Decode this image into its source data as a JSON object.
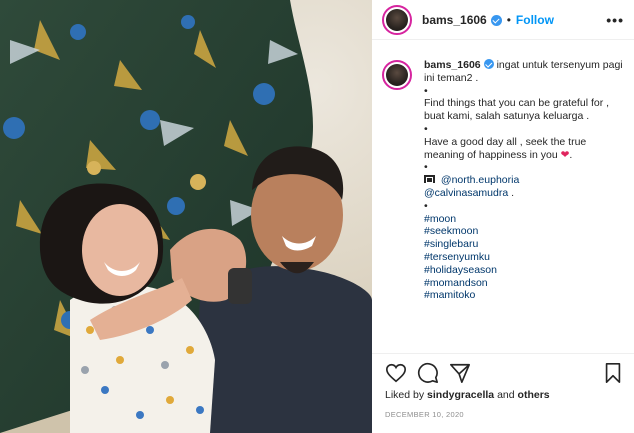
{
  "post": {
    "username": "bams_1606",
    "follow_label": "Follow",
    "more_label": "•••",
    "separator": "•"
  },
  "caption": {
    "username": "bams_1606",
    "lines": [
      "ingat untuk tersenyum pagi ini teman2 .",
      "•",
      "Find things that you can be grateful for , buat kami, salah satunya keluarga .",
      "•",
      "Have a good day all , seek the true meaning of happiness in you",
      "•"
    ],
    "heart": "❤",
    "end_dot": ".",
    "mentions": [
      "@north.euphoria",
      "@calvinasamudra"
    ],
    "mention_suffix": ".",
    "dot_after_mentions": "•",
    "hashtags": [
      "#moon",
      "#seekmoon",
      "#singlebaru",
      "#tersenyumku",
      "#holidayseason",
      "#momandson",
      "#mamitoko"
    ]
  },
  "likes": {
    "prefix": "Liked by",
    "user": "sindygracella",
    "joiner": "and",
    "others": "others"
  },
  "date": "DECEMBER 10, 2020",
  "icons": [
    "like-icon",
    "comment-icon",
    "share-icon",
    "bookmark-icon",
    "verified-badge-icon",
    "camera-icon"
  ],
  "colors": {
    "link": "#0095f6",
    "tag": "#00376b",
    "verified": "#3897f0",
    "heart": "#e0245e",
    "date": "#8e8e8e"
  }
}
